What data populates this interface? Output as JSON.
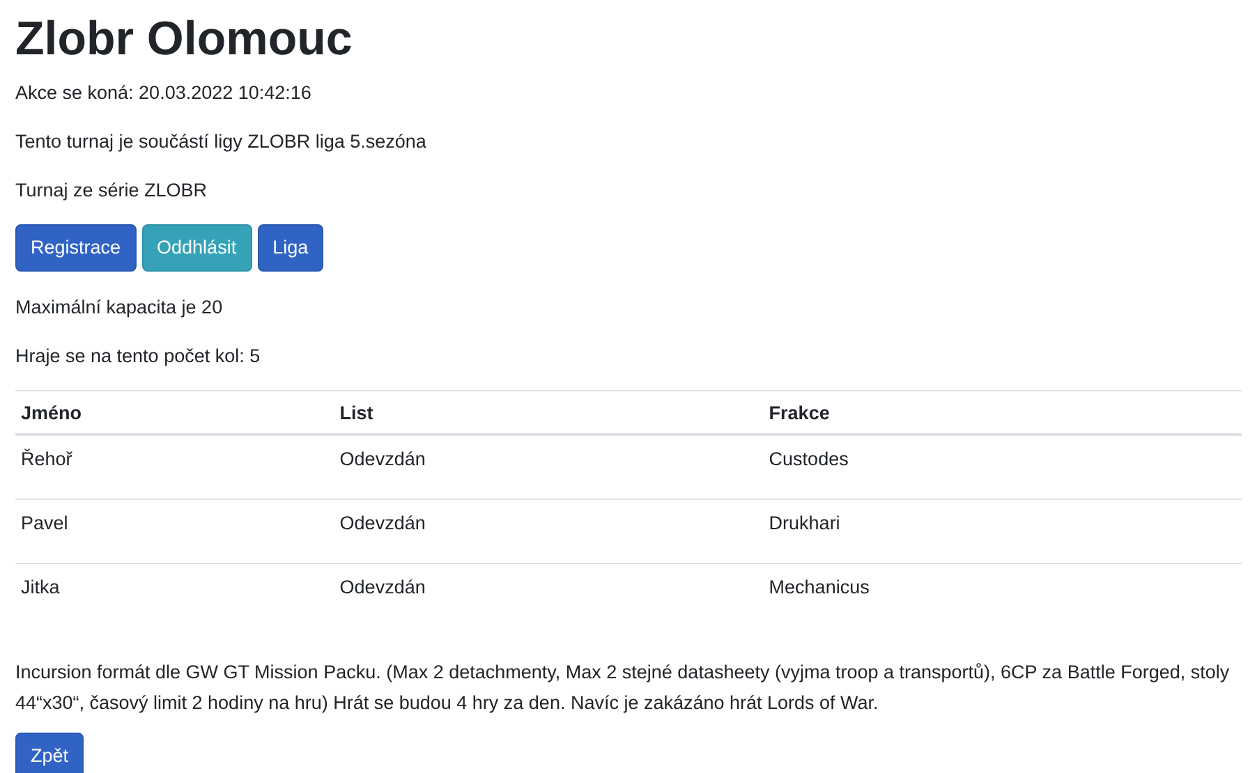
{
  "title": "Zlobr Olomouc",
  "event_time": "Akce se koná: 20.03.2022 10:42:16",
  "league_info": "Tento turnaj je součástí ligy ZLOBR liga 5.sezóna",
  "series_info": "Turnaj ze série ZLOBR",
  "buttons": [
    {
      "label": "Registrace",
      "kind": "primary"
    },
    {
      "label": "Oddhlásit",
      "kind": "info"
    },
    {
      "label": "Liga",
      "kind": "primary"
    }
  ],
  "capacity": "Maximální kapacita je 20",
  "rounds": "Hraje se na tento počet kol: 5",
  "table": {
    "columns": [
      "Jméno",
      "List",
      "Frakce"
    ],
    "rows": [
      [
        "Řehoř",
        "Odevzdán",
        "Custodes"
      ],
      [
        "Pavel",
        "Odevzdán",
        "Drukhari"
      ],
      [
        "Jitka",
        "Odevzdán",
        "Mechanicus"
      ]
    ]
  },
  "description": "Incursion formát dle GW GT Mission Packu. (Max 2 detachmenty, Max 2 stejné datasheety (vyjma troop a transportů), 6CP za Battle Forged, stoly 44“x30“, časový limit 2 hodiny na hru) Hrát se budou 4 hry za den. Navíc je zakázáno hrát Lords of War.",
  "back_button": "Zpět"
}
